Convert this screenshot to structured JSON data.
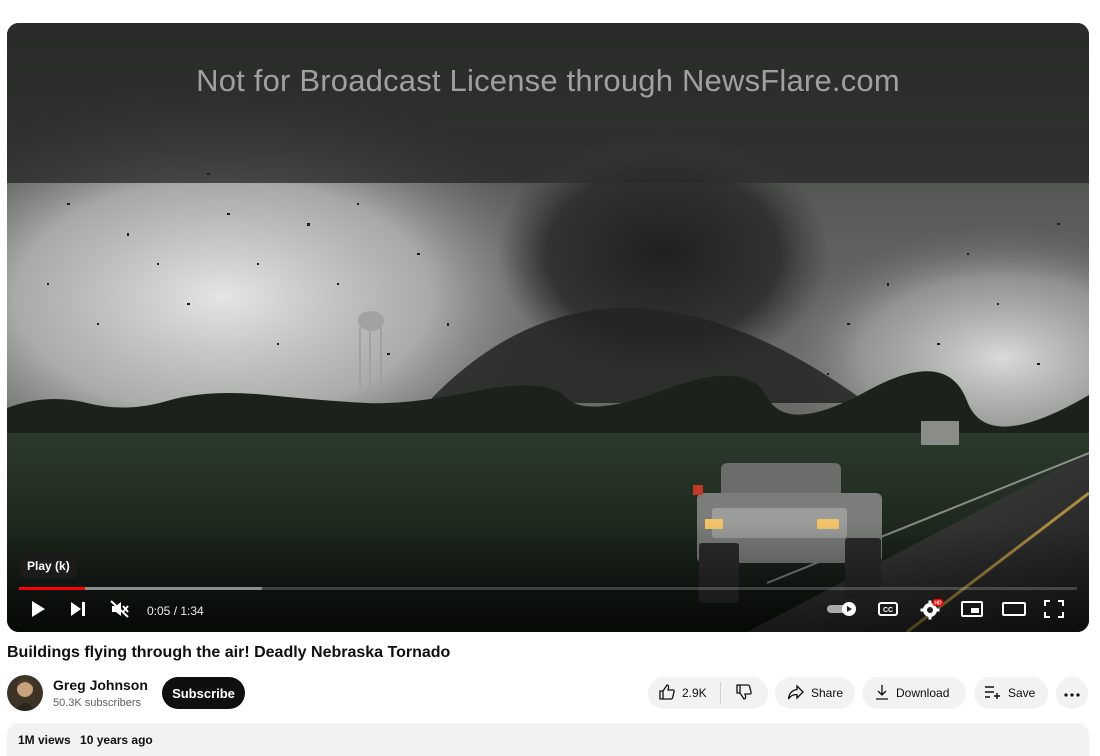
{
  "player": {
    "watermark": "Not for Broadcast License through NewsFlare.com",
    "tooltip": "Play (k)",
    "time": "0:05 / 1:34",
    "progress_played": 0.062,
    "progress_buffered": 0.23,
    "icons": [
      "play-icon",
      "next-icon",
      "mute-icon",
      "autoplay-icon",
      "captions-icon",
      "settings-icon",
      "miniplayer-icon",
      "theater-icon",
      "fullscreen-icon"
    ],
    "settings_badge": "HD",
    "accent_color": "#ff0000"
  },
  "video": {
    "title": "Buildings flying through the air! Deadly Nebraska Tornado"
  },
  "channel": {
    "name": "Greg Johnson",
    "subscribers": "50.3K subscribers",
    "subscribe_label": "Subscribe"
  },
  "actions": {
    "likes": "2.9K",
    "share": "Share",
    "download": "Download",
    "save": "Save"
  },
  "description": {
    "views": "1M views",
    "age": "10 years ago"
  }
}
